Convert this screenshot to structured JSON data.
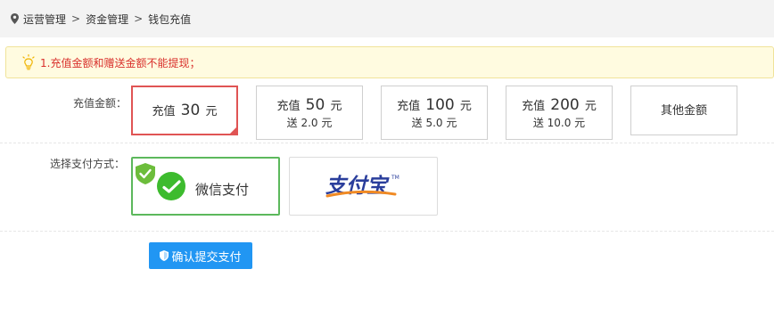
{
  "breadcrumb": {
    "items": [
      "运营管理",
      "资金管理",
      "钱包充值"
    ],
    "separator": ">"
  },
  "notice": {
    "text": "1.充值金额和赠送金额不能提现；",
    "color": "#d9302c"
  },
  "recharge": {
    "label": "充值金额：",
    "options": [
      {
        "prefix": "充值",
        "amount": "30",
        "unit": "元",
        "gift": "",
        "selected": true
      },
      {
        "prefix": "充值",
        "amount": "50",
        "unit": "元",
        "gift": "送 2.0 元",
        "selected": false
      },
      {
        "prefix": "充值",
        "amount": "100",
        "unit": "元",
        "gift": "送 5.0 元",
        "selected": false
      },
      {
        "prefix": "充值",
        "amount": "200",
        "unit": "元",
        "gift": "送 10.0 元",
        "selected": false
      },
      {
        "other_label": "其他金额",
        "selected": false
      }
    ],
    "selected_color": "#e05454"
  },
  "payment": {
    "label": "选择支付方式：",
    "methods": [
      {
        "name": "微信支付",
        "icon": "wechat-pay-icon",
        "selected": true
      },
      {
        "name": "支付宝",
        "icon": "alipay-logo",
        "selected": false
      }
    ],
    "selected_color": "#5cb85c"
  },
  "submit": {
    "label": "确认提交支付",
    "color": "#2196f3"
  }
}
